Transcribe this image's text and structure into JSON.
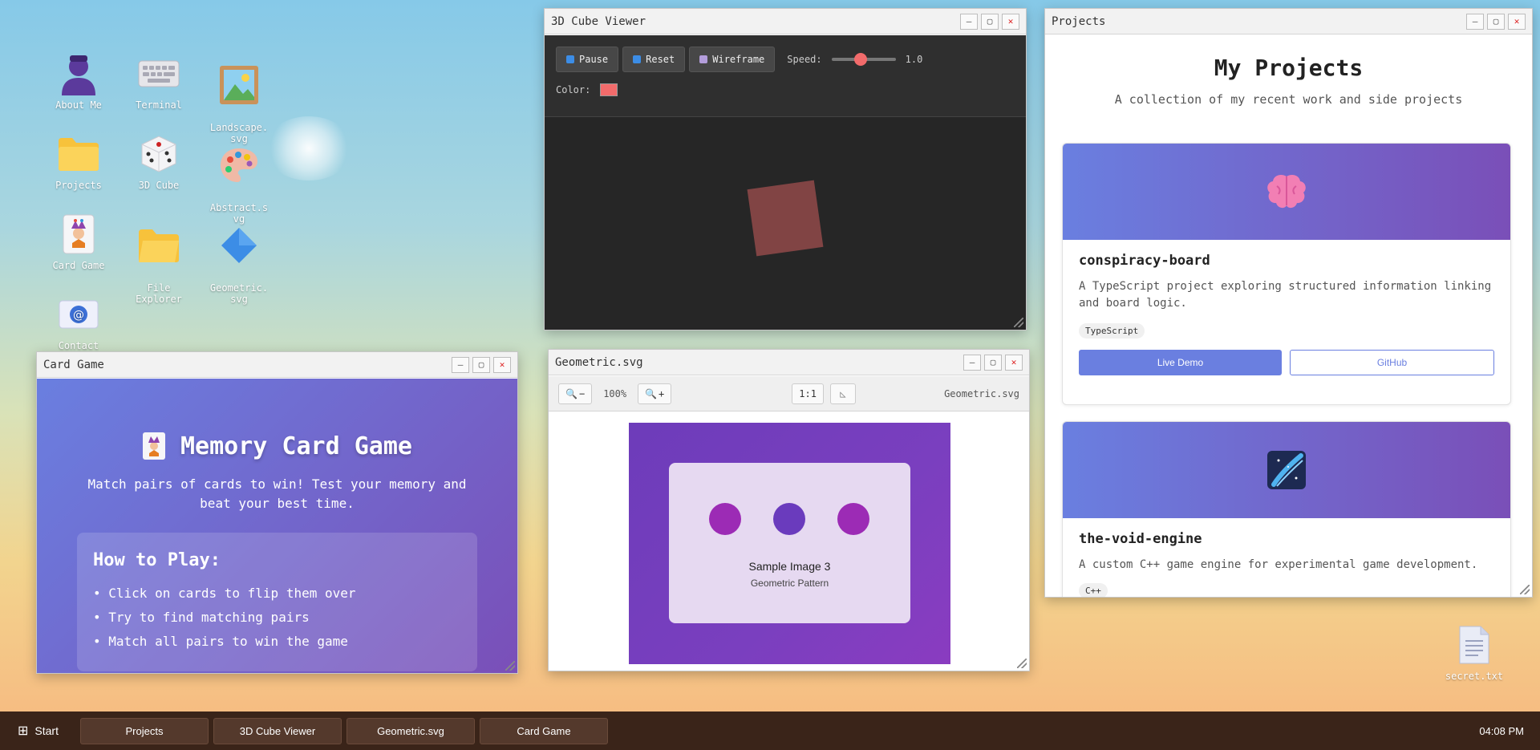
{
  "desktop": {
    "icons": [
      {
        "label": "About Me",
        "icon": "person-icon"
      },
      {
        "label": "Terminal",
        "icon": "keyboard-icon"
      },
      {
        "label": "Landscape.\nsvg",
        "icon": "image-icon"
      },
      {
        "label": "Projects",
        "icon": "folder-icon"
      },
      {
        "label": "3D Cube",
        "icon": "dice-icon"
      },
      {
        "label": "Abstract.s\nvg",
        "icon": "palette-icon"
      },
      {
        "label": "Card Game",
        "icon": "joker-card-icon"
      },
      {
        "label": "File\nExplorer",
        "icon": "folder-icon"
      },
      {
        "label": "Geometric.\nsvg",
        "icon": "diamond-icon"
      },
      {
        "label": "Contact",
        "icon": "email-icon"
      },
      {
        "label": "secret.txt",
        "icon": "text-file-icon"
      }
    ]
  },
  "cube_viewer": {
    "title": "3D Cube Viewer",
    "pause_label": "Pause",
    "reset_label": "Reset",
    "wireframe_label": "Wireframe",
    "speed_label": "Speed:",
    "speed_value": "1.0",
    "speed_fraction": 0.35,
    "color_label": "Color:",
    "cube_color": "#f26b6b"
  },
  "geometric": {
    "title": "Geometric.svg",
    "zoom_level": "100%",
    "actual_size_label": "1:1",
    "filename": "Geometric.svg",
    "image_title": "Sample Image 3",
    "image_subtitle": "Geometric Pattern"
  },
  "projects": {
    "title": "Projects",
    "heading": "My Projects",
    "subheading": "A collection of my recent work and side projects",
    "cards": [
      {
        "name": "conspiracy-board",
        "description": "A TypeScript project exploring structured information linking and board logic.",
        "tag": "TypeScript",
        "demo_label": "Live Demo",
        "github_label": "GitHub",
        "icon": "brain-icon"
      },
      {
        "name": "the-void-engine",
        "description": "A custom C++ game engine for experimental game development.",
        "tag": "C++",
        "icon": "comet-icon"
      }
    ]
  },
  "card_game": {
    "title": "Card Game",
    "heading": "Memory Card Game",
    "intro": "Match pairs of cards to win! Test your memory and beat your best time.",
    "howto_title": "How to Play:",
    "rules": [
      "Click on cards to flip them over",
      "Try to find matching pairs",
      "Match all pairs to win the game"
    ]
  },
  "taskbar": {
    "start_label": "Start",
    "items": [
      "Projects",
      "3D Cube Viewer",
      "Geometric.svg",
      "Card Game"
    ],
    "clock": "04:08 PM"
  },
  "colors": {
    "accent": "#6a7fe0",
    "taskbar": "#3a2419",
    "close": "#dd2222"
  }
}
